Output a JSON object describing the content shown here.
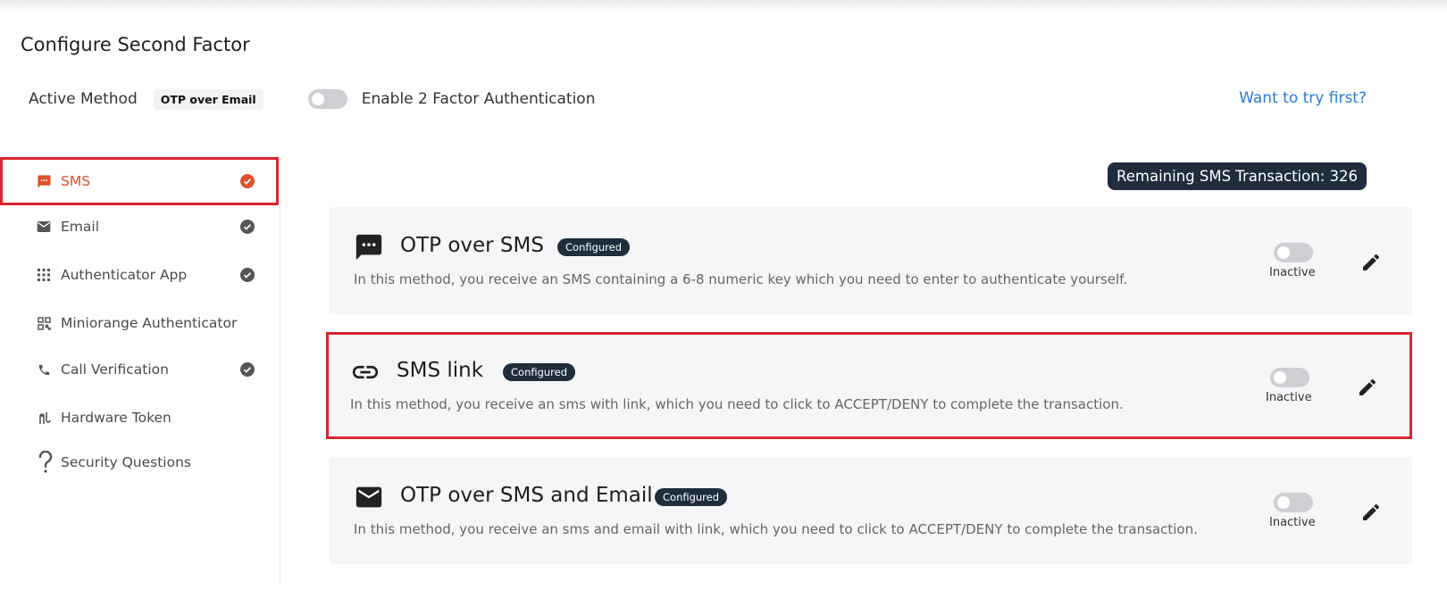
{
  "header": {
    "title": "Configure Second Factor",
    "active_method_label": "Active Method",
    "active_method_value": "OTP over Email",
    "enable_2fa_label": "Enable 2 Factor Authentication",
    "enable_2fa_on": false,
    "try_first_link": "Want to try first?"
  },
  "sidebar": {
    "items": [
      {
        "label": "SMS",
        "icon": "sms-icon",
        "configured": true,
        "selected": true
      },
      {
        "label": "Email",
        "icon": "mail-icon",
        "configured": true,
        "selected": false
      },
      {
        "label": "Authenticator App",
        "icon": "grid-dots-icon",
        "configured": true,
        "selected": false
      },
      {
        "label": "Miniorange Authenticator",
        "icon": "qr-code-icon",
        "configured": false,
        "selected": false
      },
      {
        "label": "Call Verification",
        "icon": "phone-icon",
        "configured": true,
        "selected": false
      },
      {
        "label": "Hardware Token",
        "icon": "token-icon",
        "configured": false,
        "selected": false
      },
      {
        "label": "Security Questions",
        "icon": "question-icon",
        "configured": false,
        "selected": false
      }
    ]
  },
  "main": {
    "remaining_sms": "Remaining SMS Transaction: 326",
    "methods": [
      {
        "title": "OTP over SMS",
        "badge": "Configured",
        "description": "In this method, you receive an SMS containing a 6-8 numeric key which you need to enter to authenticate yourself.",
        "status": "Inactive",
        "icon": "sms-dots-icon"
      },
      {
        "title": "SMS link",
        "badge": "Configured",
        "description": "In this method, you receive an sms with link, which you need to click to ACCEPT/DENY to complete the transaction.",
        "status": "Inactive",
        "icon": "link-icon"
      },
      {
        "title": "OTP over SMS and Email",
        "badge": "Configured",
        "description": "In this method, you receive an sms and email with link, which you need to click to ACCEPT/DENY to complete the transaction.",
        "status": "Inactive",
        "icon": "envelope-icon"
      }
    ]
  },
  "colors": {
    "accent_orange": "#e0512a",
    "highlight_red": "#d9262f",
    "dark_badge": "#1f2d3d",
    "link_blue": "#2a7ad5"
  }
}
